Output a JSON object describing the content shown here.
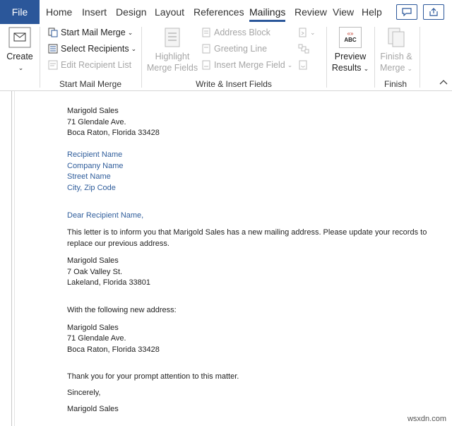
{
  "tabs": {
    "file": "File",
    "home": "Home",
    "insert": "Insert",
    "design": "Design",
    "layout": "Layout",
    "references": "References",
    "mailings": "Mailings",
    "review": "Review",
    "view": "View",
    "help": "Help"
  },
  "ribbon": {
    "create_label": "Create",
    "start_mail_merge": "Start Mail Merge",
    "select_recipients": "Select Recipients",
    "edit_recipient_list": "Edit Recipient List",
    "group_start": "Start Mail Merge",
    "highlight_line1": "Highlight",
    "highlight_line2": "Merge Fields",
    "address_block": "Address Block",
    "greeting_line": "Greeting Line",
    "insert_merge_field": "Insert Merge Field",
    "group_write": "Write & Insert Fields",
    "preview_icon_text": "ABC",
    "preview_line1": "Preview",
    "preview_line2": "Results",
    "finish_line1": "Finish &",
    "finish_line2": "Merge",
    "group_finish": "Finish"
  },
  "document": {
    "sender": [
      "Marigold Sales",
      "71 Glendale Ave.",
      "Boca Raton, Florida 33428"
    ],
    "recipient_fields": [
      "Recipient Name",
      "Company Name",
      "Street Name",
      "City, Zip Code"
    ],
    "greeting": "Dear Recipient Name,",
    "body_line1": "This letter is to inform you that Marigold Sales has a new mailing address. Please update your records to",
    "body_line2": "replace our previous address.",
    "old_address": [
      "Marigold Sales",
      "7 Oak Valley St.",
      "Lakeland, Florida 33801"
    ],
    "new_address_intro": "With the following new address:",
    "new_address": [
      "Marigold Sales",
      "71 Glendale Ave.",
      "Boca Raton, Florida 33428"
    ],
    "thanks": "Thank you for your prompt attention to this matter.",
    "closing": "Sincerely,",
    "signature": "Marigold Sales"
  },
  "watermark": "wsxdn.com",
  "colors": {
    "accent": "#2b579a",
    "field": "#2f5d9b",
    "disabled": "#a6a6a6"
  }
}
